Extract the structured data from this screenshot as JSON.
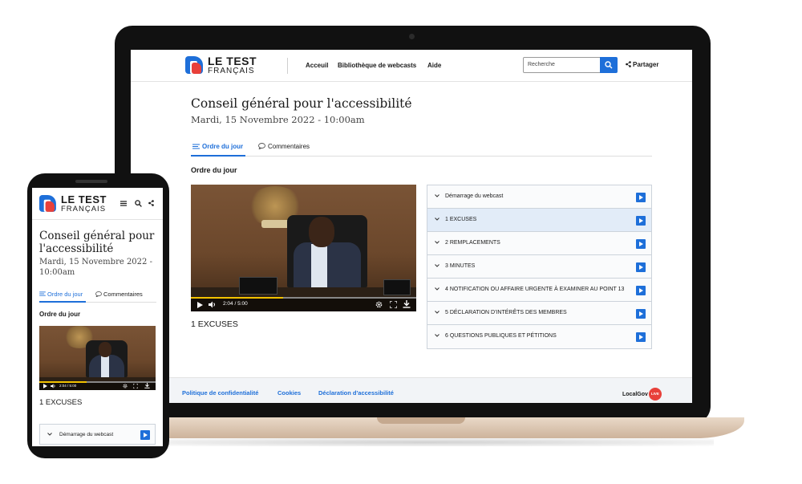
{
  "brand": {
    "line1": "LE TEST",
    "line2": "FRANÇAIS",
    "blue": "#1e6fd9",
    "red": "#e8403a"
  },
  "nav": {
    "items": [
      "Acceuil",
      "Bibliothèque de webcasts",
      "Aide"
    ]
  },
  "search": {
    "placeholder": "Recherche"
  },
  "share": {
    "label": "Partager"
  },
  "meeting": {
    "title": "Conseil général pour l'accessibilité",
    "date": "Mardi, 15 Novembre 2022 - 10:00am"
  },
  "tabs": {
    "agenda": "Ordre du jour",
    "comments": "Commentaires"
  },
  "section": {
    "heading": "Ordre du jour"
  },
  "player": {
    "time": "2:04 / 5:00",
    "progress": 0.41
  },
  "current_item": "1 EXCUSES",
  "agenda": [
    {
      "label": "Démarrage du webcast",
      "active": false
    },
    {
      "label": "1 EXCUSES",
      "active": true
    },
    {
      "label": "2 REMPLACEMENTS",
      "active": false
    },
    {
      "label": "3 MINUTES",
      "active": false
    },
    {
      "label": "4 NOTIFICATION OU AFFAIRE URGENTE À EXAMINER AU POINT 13",
      "active": false
    },
    {
      "label": "5 DÉCLARATION D'INTÉRÊTS DES MEMBRES",
      "active": false
    },
    {
      "label": "6 QUESTIONS PUBLIQUES ET PÉTITIONS",
      "active": false
    }
  ],
  "footer": {
    "links": [
      "Politique de confidentialité",
      "Cookies",
      "Déclaration d'accessibilité"
    ],
    "brand": "LocalGov",
    "badge": "LIVE"
  },
  "mobile": {
    "title": "Conseil général pour l'accessibilité",
    "date": "Mardi, 15 Novembre 2022 - 10:00am",
    "first_agenda": "Démarrage du webcast"
  },
  "icons": [
    "search-icon",
    "share-icon",
    "menu-icon",
    "list-icon",
    "comment-icon",
    "chevron-down-icon",
    "play-icon",
    "volume-icon",
    "settings-icon",
    "fullscreen-icon",
    "download-icon"
  ]
}
